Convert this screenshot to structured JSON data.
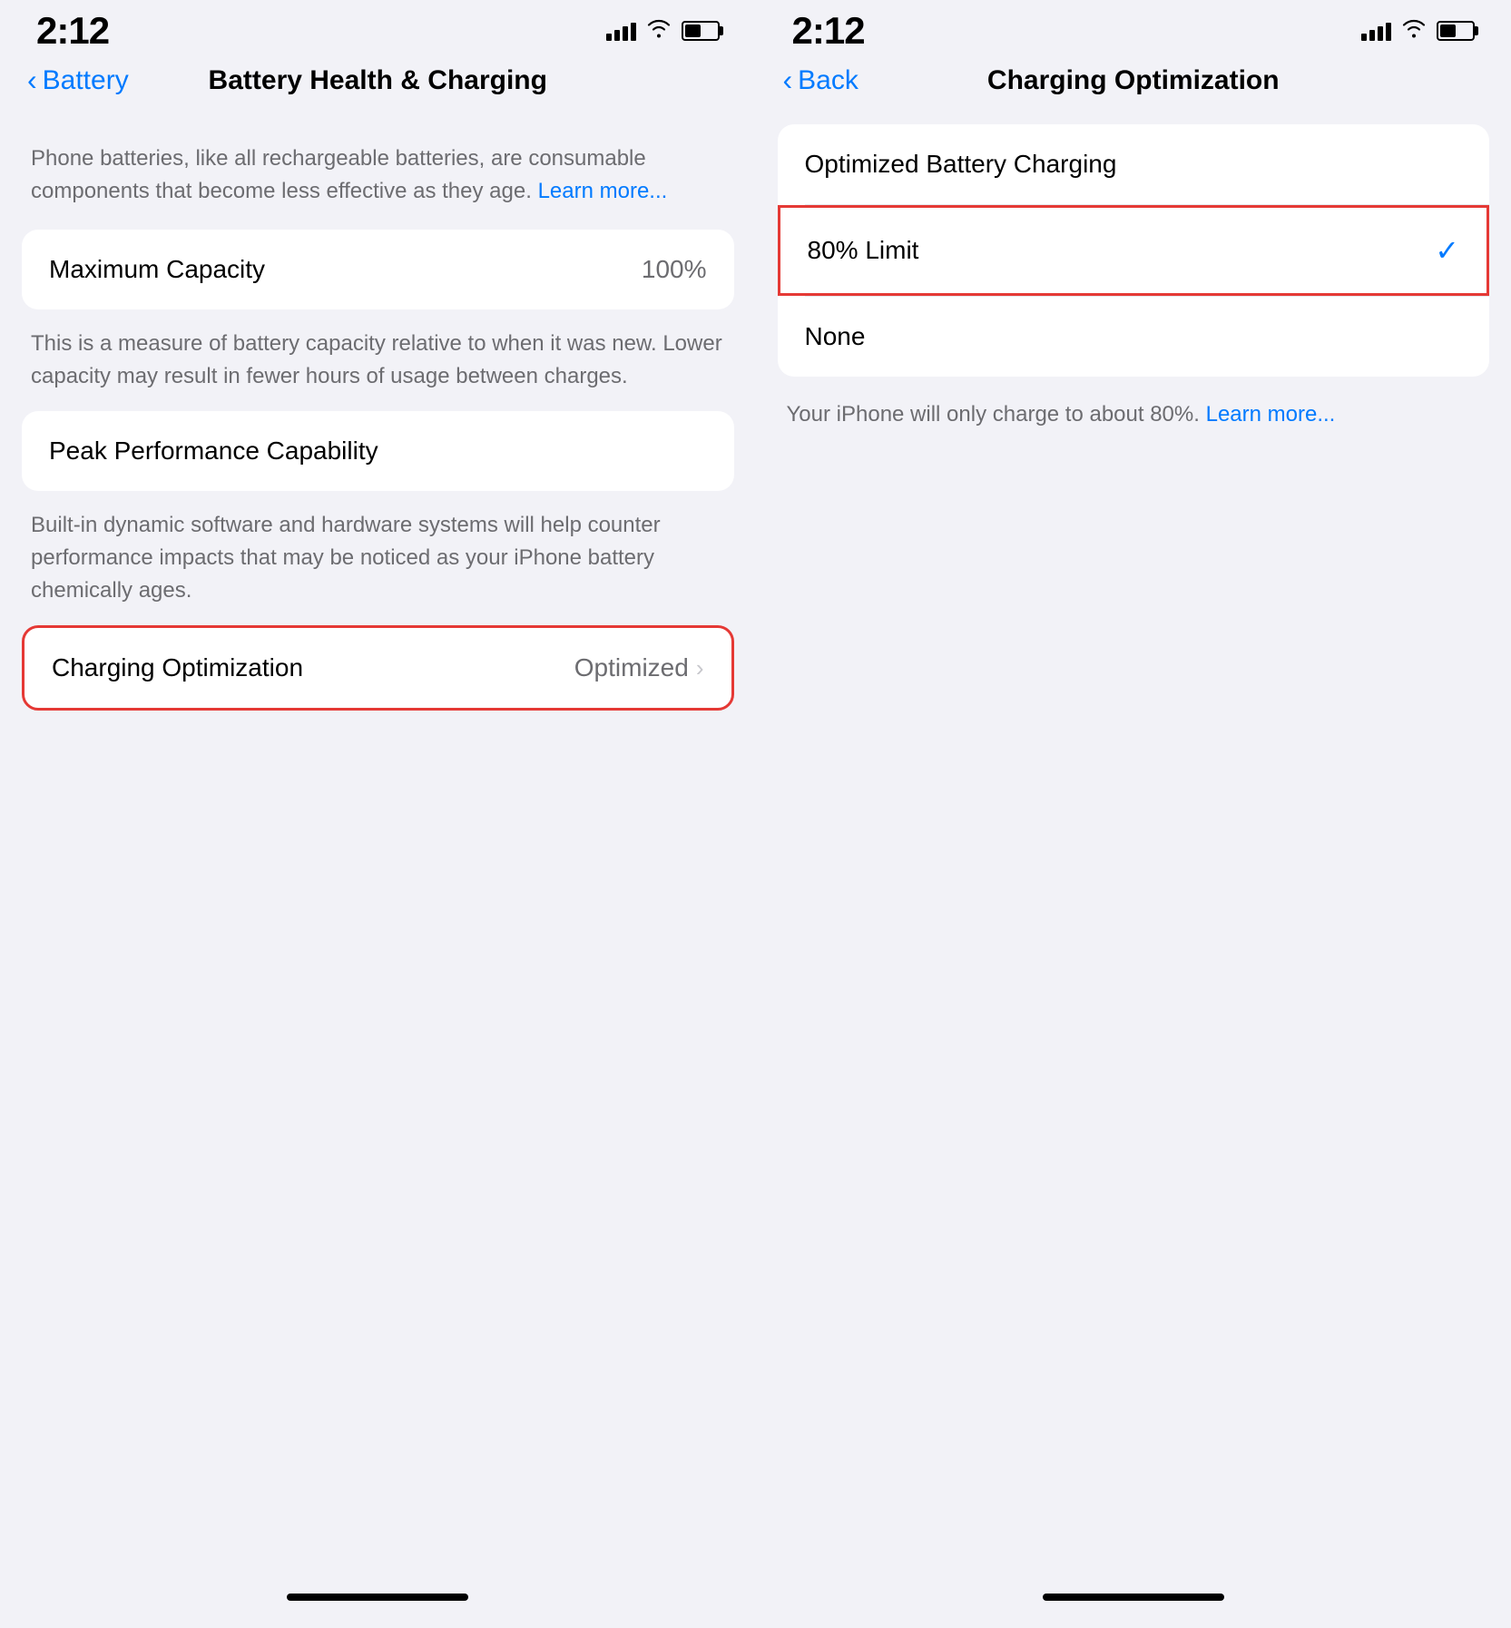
{
  "left_screen": {
    "status": {
      "time": "2:12"
    },
    "nav": {
      "back_label": "Battery",
      "title": "Battery Health & Charging"
    },
    "intro": {
      "text": "Phone batteries, like all rechargeable batteries, are consumable components that become less effective as they age.",
      "learn_more": "Learn more..."
    },
    "maximum_capacity": {
      "label": "Maximum Capacity",
      "value": "100%",
      "description": "This is a measure of battery capacity relative to when it was new. Lower capacity may result in fewer hours of usage between charges."
    },
    "peak_performance": {
      "label": "Peak Performance Capability",
      "description": "Built-in dynamic software and hardware systems will help counter performance impacts that may be noticed as your iPhone battery chemically ages."
    },
    "charging_optimization": {
      "label": "Charging Optimization",
      "value": "Optimized"
    }
  },
  "right_screen": {
    "status": {
      "time": "2:12"
    },
    "nav": {
      "back_label": "Back",
      "title": "Charging Optimization"
    },
    "options": {
      "header": "Optimized Battery Charging",
      "option_80_limit": "80% Limit",
      "option_none": "None"
    },
    "footer": {
      "text": "Your iPhone will only charge to about 80%.",
      "learn_more": "Learn more..."
    }
  }
}
